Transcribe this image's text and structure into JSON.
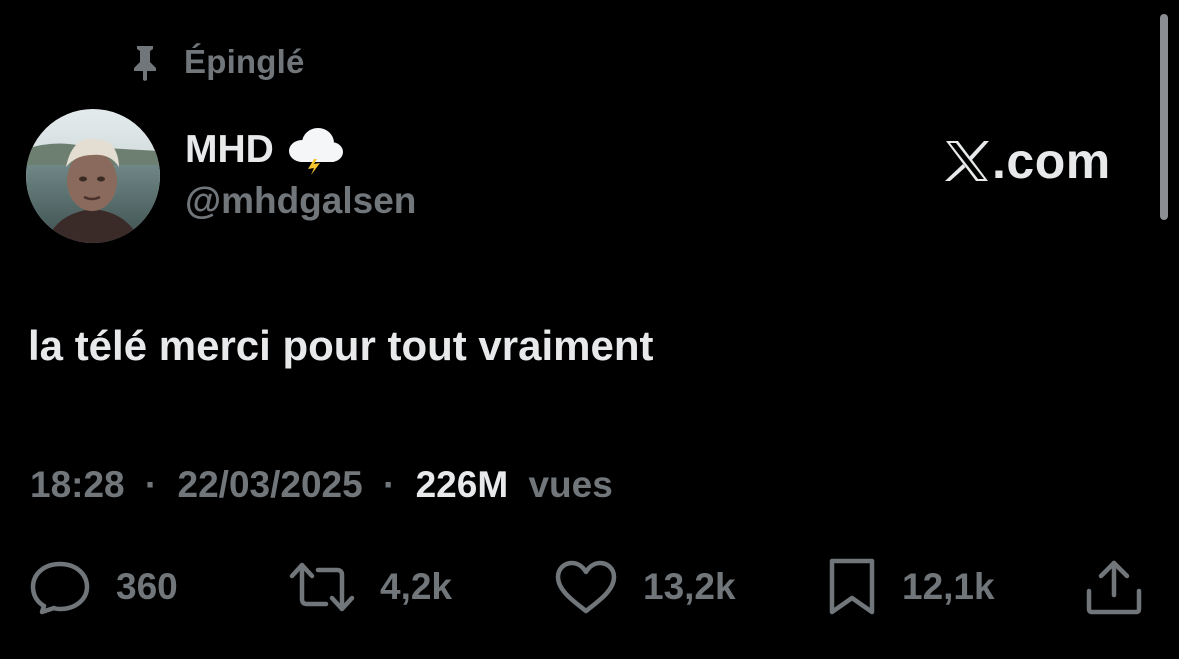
{
  "pinned": {
    "label": "Épinglé",
    "icon": "pin-icon"
  },
  "author": {
    "display_name": "MHD",
    "emoji_icon": "cloud-lightning-icon",
    "handle": "@mhdgalsen",
    "avatar": "avatar-photo"
  },
  "brand": {
    "logo_icon": "x-logo-icon",
    "suffix": ".com"
  },
  "tweet": {
    "text": "la télé merci pour tout vraiment"
  },
  "meta": {
    "time": "18:28",
    "separator": "·",
    "date": "22/03/2025",
    "views_count": "226M",
    "views_label": "vues"
  },
  "actions": {
    "reply": {
      "icon": "reply-icon",
      "count": "360"
    },
    "repost": {
      "icon": "repost-icon",
      "count": "4,2k"
    },
    "like": {
      "icon": "heart-icon",
      "count": "13,2k"
    },
    "bookmark": {
      "icon": "bookmark-icon",
      "count": "12,1k"
    },
    "share": {
      "icon": "share-icon"
    }
  },
  "colors": {
    "background": "#000000",
    "primary_text": "#e7e9ea",
    "secondary_text": "#71767b"
  }
}
